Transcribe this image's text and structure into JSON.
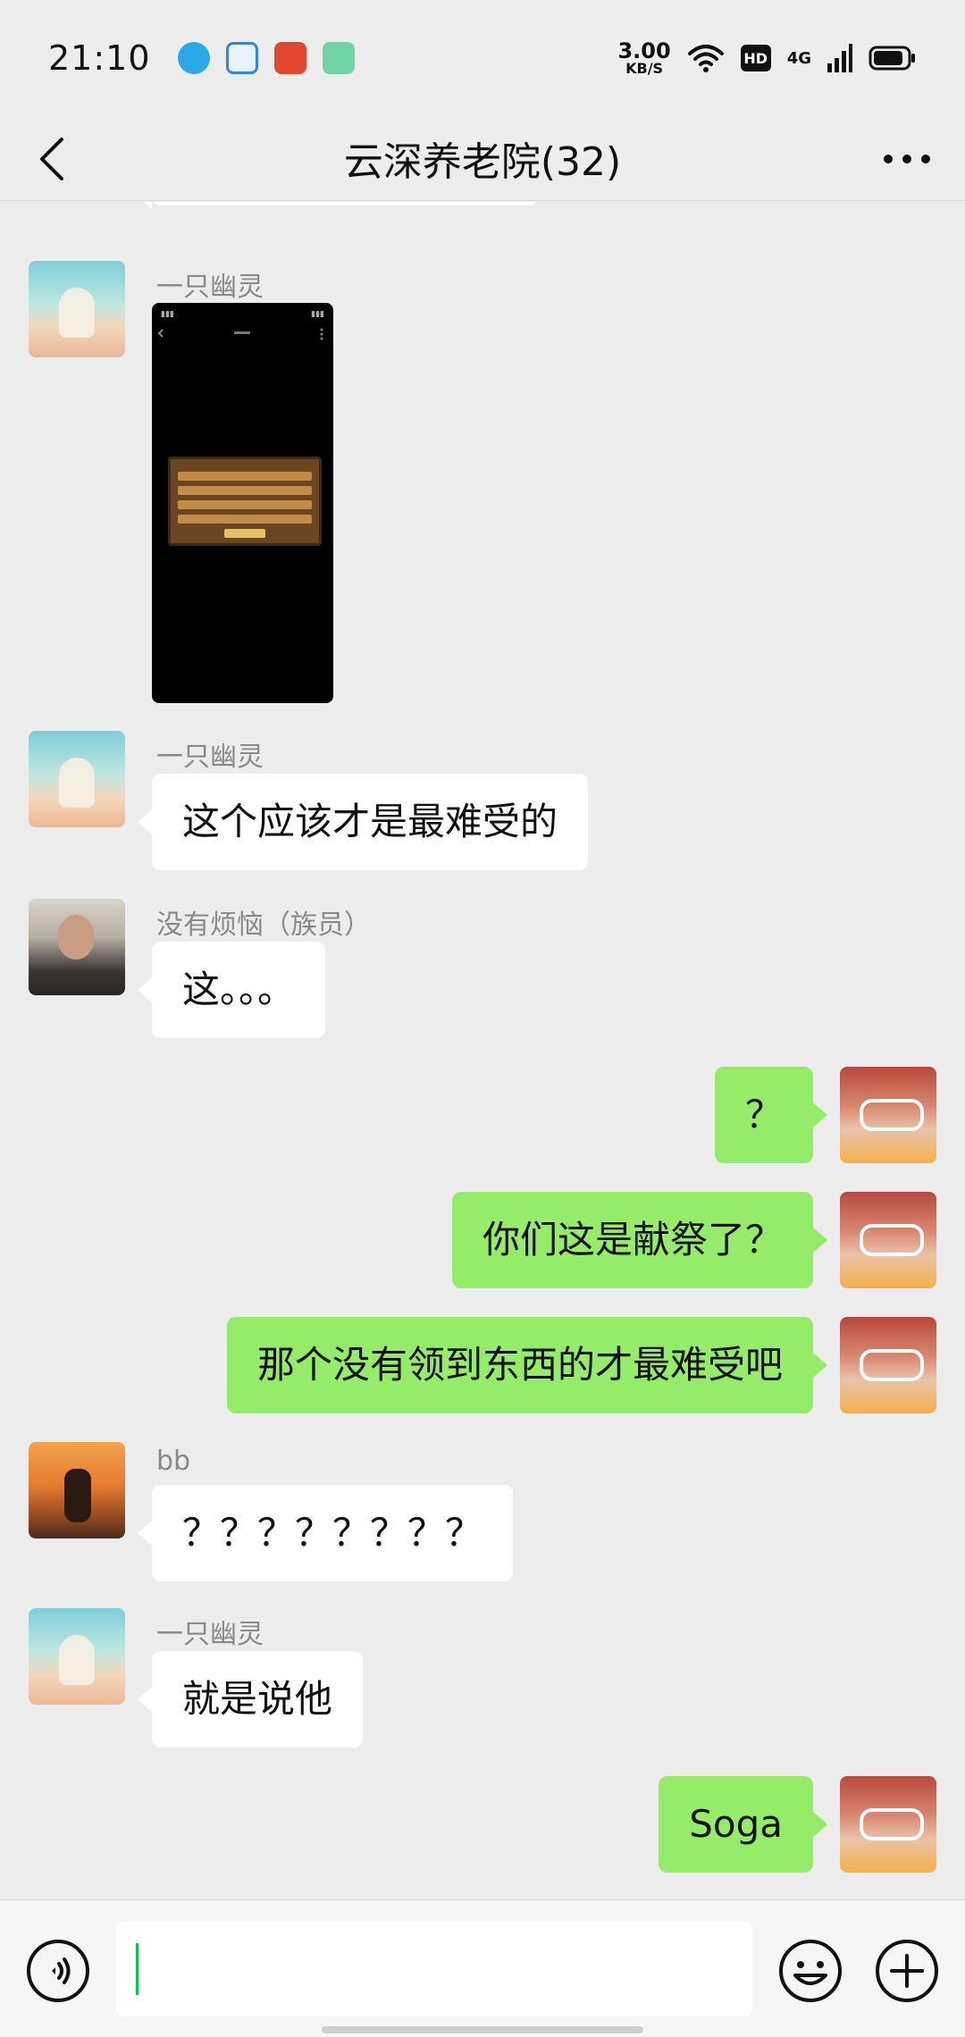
{
  "status_bar": {
    "time": "21:10",
    "net_speed_value": "3.00",
    "net_speed_unit": "KB/S",
    "hd": "HD",
    "signal": "4G",
    "app_icons": [
      "qq-icon",
      "browser-icon",
      "red-app-icon",
      "green-app-icon"
    ]
  },
  "header": {
    "title": "云深养老院(32)"
  },
  "messages": [
    {
      "sender": "一只幽灵",
      "type": "image"
    },
    {
      "sender": "一只幽灵",
      "text": "这个应该才是最难受的"
    },
    {
      "sender": "没有烦恼（族员）",
      "text": "这。。。"
    },
    {
      "sender": "me",
      "text": "？"
    },
    {
      "sender": "me",
      "text": "你们这是献祭了？"
    },
    {
      "sender": "me",
      "text": "那个没有领到东西的才最难受吧"
    },
    {
      "sender": "bb",
      "text": "？？？？？？？？"
    },
    {
      "sender": "一只幽灵",
      "text": "就是说他"
    },
    {
      "sender": "me",
      "text": "Soga"
    }
  ],
  "input_bar": {
    "placeholder": "",
    "value": ""
  },
  "colors": {
    "background": "#ededed",
    "outgoing_bubble": "#95ec69",
    "incoming_bubble": "#ffffff",
    "caret": "#07c160"
  }
}
